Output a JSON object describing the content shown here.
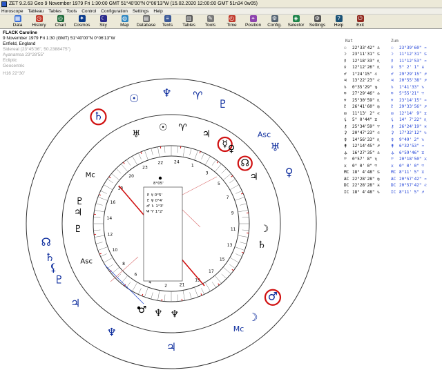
{
  "titlebar": {
    "text": "ZET 9.2.63 Geo    9 November 1979  Fri   1:30:00 GMT 51°40'00\"N  0°06'13\"W  (15.02.2020  12:00:00 GMT 51n34 0w05)"
  },
  "menu": [
    "Horoscope",
    "Tableau",
    "Tables",
    "Tools",
    "Control",
    "Configuration",
    "Settings",
    "Help"
  ],
  "toolbar": [
    {
      "label": "Data",
      "icon": "data-icon",
      "color": "#3a6fd8",
      "glyph": "▦"
    },
    {
      "label": "History",
      "icon": "history-icon",
      "color": "#c0392b",
      "glyph": "◷"
    },
    {
      "label": "Chart",
      "icon": "chart-icon",
      "color": "#1d6b3a",
      "glyph": "◎"
    },
    {
      "label": "Cosmos",
      "icon": "cosmos-icon",
      "color": "#0b3b8c",
      "glyph": "✦"
    },
    {
      "label": "Sky",
      "icon": "sky-icon",
      "color": "#2b2b8c",
      "glyph": "☾"
    },
    {
      "label": "Map",
      "icon": "map-icon",
      "color": "#2e86c1",
      "glyph": "◍"
    },
    {
      "label": "Database",
      "icon": "database-icon",
      "color": "#6e6e6e",
      "glyph": "▤"
    },
    {
      "label": "Texts",
      "icon": "texts-icon",
      "color": "#3b5998",
      "glyph": "≡"
    },
    {
      "label": "Tables",
      "icon": "tables-icon",
      "color": "#555555",
      "glyph": "▥"
    },
    {
      "label": "Tools",
      "icon": "tools-icon",
      "color": "#7a7a7a",
      "glyph": "✎"
    },
    {
      "label": "Time",
      "icon": "time-icon",
      "color": "#c0392b",
      "glyph": "◴"
    },
    {
      "label": "Position",
      "icon": "position-icon",
      "color": "#8e44ad",
      "glyph": "⌖"
    },
    {
      "label": "Config.",
      "icon": "config-icon",
      "color": "#566573",
      "glyph": "⚙"
    },
    {
      "label": "Selector",
      "icon": "selector-icon",
      "color": "#1e8449",
      "glyph": "◈"
    },
    {
      "label": "Settings",
      "icon": "settings-icon",
      "color": "#555555",
      "glyph": "⚙"
    },
    {
      "label": "Help",
      "icon": "help-icon",
      "color": "#1a5276",
      "glyph": "?"
    },
    {
      "label": "Exit",
      "icon": "exit-icon",
      "color": "#922b21",
      "glyph": "⏻"
    }
  ],
  "info": {
    "name": "FLACK Caroline",
    "date_line": "9 November 1979  Fri   1:30 (GMT) 51°40'00\"N  0°06'13\"W",
    "place": "Enfield, England",
    "sidereal": "Sidereal (23°45'36\", 50.2388475\")",
    "ayanamsa": "Ayanamsa 23°28'55\"",
    "ecliptic": "Ecliptic",
    "geocentric": "Geocentric",
    "hsys": "H16  22°30'"
  },
  "table": {
    "headers": [
      "Nat",
      "Zum"
    ],
    "rows": [
      {
        "g1": "☉",
        "v1": "22°33'42\" ♎",
        "g2": "☉",
        "v2": "23°39'60\" ♒"
      },
      {
        "g1": "☽",
        "v1": "23°11'31\" ♋",
        "g2": "☽",
        "v2": "11°12'31\" ♋"
      },
      {
        "g1": "☿",
        "v1": "12°18'33\" ♏",
        "g2": "☿",
        "v2": "11°12'53\" ♒"
      },
      {
        "g1": "♀",
        "v1": "12°12'26\" ♏",
        "g2": "♀",
        "v2": "5° 2' 1\" ♓"
      },
      {
        "g1": "♂",
        "v1": "1°24'15\" ♌",
        "g2": "♂",
        "v2": "29°29'15\" ♐"
      },
      {
        "g1": "♃",
        "v1": "13°22'23\" ♌",
        "g2": "♃",
        "v2": "20°55'38\" ♐"
      },
      {
        "g1": "♄",
        "v1": "0°35'29\" ♍",
        "g2": "♄",
        "v2": "1°41'33\" ♑"
      },
      {
        "g1": "♅",
        "v1": "27°29'46\" ♎",
        "g2": "♅",
        "v2": "5°55'21\" ♈"
      },
      {
        "g1": "♆",
        "v1": "25°30'59\" ♏",
        "g2": "♆",
        "v2": "23°14'15\" ♒"
      },
      {
        "g1": "♇",
        "v1": "26°41'60\" ♍",
        "g2": "♇",
        "v2": "29°33'56\" ♐"
      },
      {
        "g1": "☊",
        "v1": "11°13' 2\" ♌",
        "g2": "☊",
        "v2": "12°14' 9\" ♊"
      },
      {
        "g1": "⚸",
        "v1": "5° 0'44\" ♊",
        "g2": "⚸",
        "v2": "14° 7'22\" ♏"
      },
      {
        "g1": "⚷",
        "v1": "25°34'59\" ♈",
        "g2": "⚷",
        "v2": "26°24'19\" ♓"
      },
      {
        "g1": "⚳",
        "v1": "20°47'23\" ♌",
        "g2": "⚳",
        "v2": "17°32'12\" ♑"
      },
      {
        "g1": "⚴",
        "v1": "14°56'33\" ♏",
        "g2": "⚴",
        "v2": "9°49' 2\" ♑"
      },
      {
        "g1": "⚵",
        "v1": "12°14'45\" ♐",
        "g2": "⚵",
        "v2": "6°32'53\" ♒"
      },
      {
        "g1": "⚶",
        "v1": "16°27'35\" ♎",
        "g2": "⚶",
        "v2": "6°59'46\" ♊"
      },
      {
        "g1": "♈",
        "v1": "0°57' 8\" ♏",
        "g2": "♈",
        "v2": "20°18'50\" ♓"
      },
      {
        "g1": "♓",
        "v1": "0° 0' 0\" ♈",
        "g2": "♓",
        "v2": "0° 0' 0\" ♈"
      },
      {
        "g1": "MC",
        "v1": "18° 4'48\" ♋",
        "g2": "MC",
        "v2": "8°11' 5\" ♊"
      },
      {
        "g1": "AC",
        "v1": "22°28'28\" ♍",
        "g2": "AC",
        "v2": "20°57'42\" ♒"
      },
      {
        "g1": "DC",
        "v1": "22°28'28\" ♓",
        "g2": "DC",
        "v2": "20°57'42\" ♌"
      },
      {
        "g1": "IC",
        "v1": "18° 4'48\" ♑",
        "g2": "IC",
        "v2": "8°11' 5\" ♐"
      }
    ]
  },
  "chart": {
    "center_box": [
      "8°05'",
      "♇ ☿ 0°5'",
      "♇ ♀ 0°4'",
      "♂ ♄ 1°3'",
      "Ψ ♈ 1°2'"
    ],
    "house_numbers": [
      "22",
      "24",
      "1",
      "3",
      "5",
      "7",
      "9",
      "11",
      "13",
      "15",
      "17",
      "19",
      "21",
      "2",
      "4",
      "6",
      "8",
      "10",
      "12",
      "14",
      "16",
      "18",
      "20",
      "23"
    ],
    "outer_glyphs": [
      {
        "g": "♄",
        "c": "#0a2a9c",
        "circle": true
      },
      {
        "g": "☉",
        "c": "#0a2a9c",
        "circle": false
      },
      {
        "g": "♆",
        "c": "#0a2a9c",
        "circle": false
      },
      {
        "g": "♈",
        "c": "#0a2a9c",
        "circle": false
      },
      {
        "g": "♇",
        "c": "#0a2a9c",
        "circle": false
      },
      {
        "g": "Asc",
        "c": "#0a2a9c",
        "circle": false
      },
      {
        "g": "♅",
        "c": "#0a2a9c",
        "circle": false
      },
      {
        "g": "♀",
        "c": "#0a2a9c",
        "circle": false
      },
      {
        "g": "♂",
        "c": "#0a2a9c",
        "circle": true
      },
      {
        "g": "☽",
        "c": "#0a2a9c",
        "circle": false
      },
      {
        "g": "Mc",
        "c": "#0a2a9c",
        "circle": false
      },
      {
        "g": "♃",
        "c": "#0a2a9c",
        "circle": false
      },
      {
        "g": "♆",
        "c": "#0a2a9c",
        "circle": false
      },
      {
        "g": "♃",
        "c": "#0a2a9c",
        "circle": false
      },
      {
        "g": "♇",
        "c": "#0a2a9c",
        "circle": false
      },
      {
        "g": "⚸",
        "c": "#0a2a9c",
        "circle": false
      },
      {
        "g": "♄",
        "c": "#0a2a9c",
        "circle": false
      },
      {
        "g": "☊",
        "c": "#0a2a9c",
        "circle": false
      }
    ],
    "inner_glyphs": [
      {
        "g": "♅",
        "c": "#000"
      },
      {
        "g": "☉",
        "c": "#000"
      },
      {
        "g": "♈",
        "c": "#000"
      },
      {
        "g": "♃",
        "c": "#000"
      },
      {
        "g": "☿",
        "c": "#000",
        "circle": true
      },
      {
        "g": "♀",
        "c": "#000"
      },
      {
        "g": "☊",
        "c": "#000",
        "circle": true
      },
      {
        "g": "♃",
        "c": "#000"
      },
      {
        "g": "☽",
        "c": "#000"
      },
      {
        "g": "♄",
        "c": "#000"
      },
      {
        "g": "♆",
        "c": "#000"
      },
      {
        "g": "♆",
        "c": "#000"
      },
      {
        "g": "♂",
        "c": "#000"
      },
      {
        "g": "♇",
        "c": "#000"
      },
      {
        "g": "♃",
        "c": "#000"
      },
      {
        "g": "♇",
        "c": "#000"
      },
      {
        "g": "Mc",
        "c": "#000"
      },
      {
        "g": "Asc",
        "c": "#000"
      }
    ],
    "accent": "#1a3cd6",
    "highlight": "#d01010"
  }
}
